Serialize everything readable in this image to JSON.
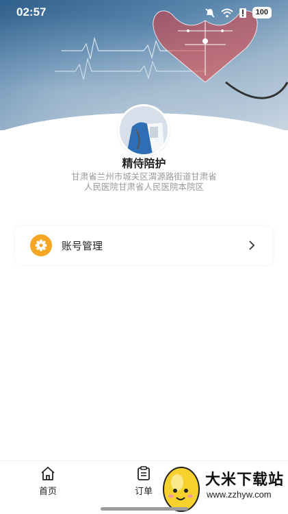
{
  "status_bar": {
    "time": "02:57",
    "battery": "100"
  },
  "profile": {
    "name": "精侍陪护",
    "address": "甘肃省兰州市城关区渭源路街道甘肃省人民医院甘肃省人民医院本院区"
  },
  "menu": [
    {
      "label": "账号管理",
      "icon": "gear-icon"
    }
  ],
  "tabbar": {
    "items": [
      {
        "label": "首页",
        "icon": "home-icon"
      },
      {
        "label": "订单",
        "icon": "clipboard-icon"
      }
    ]
  },
  "watermark": {
    "title": "大米下载站",
    "url": "www.zzhyw.com"
  },
  "colors": {
    "accent": "#f5a623",
    "banner": "#5a86ad"
  }
}
